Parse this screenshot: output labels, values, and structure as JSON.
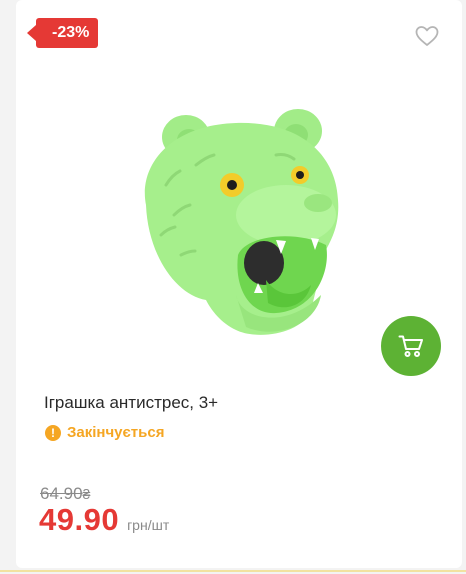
{
  "product": {
    "discount_label": "-23%",
    "title": "Іграшка антистрес, 3+",
    "stock_status": "Закінчується",
    "status_icon_glyph": "!",
    "old_price": "64.90",
    "old_price_currency_mark": "₴",
    "new_price": "49.90",
    "price_unit": "грн/шт"
  },
  "icons": {
    "favorite": "heart-outline-icon",
    "cart": "shopping-cart-icon",
    "status": "warning-circle-icon"
  },
  "colors": {
    "discount": "#e53935",
    "price": "#e53935",
    "cart_button": "#5db234",
    "status": "#f5a623",
    "product_green": "#a6ef8c"
  }
}
